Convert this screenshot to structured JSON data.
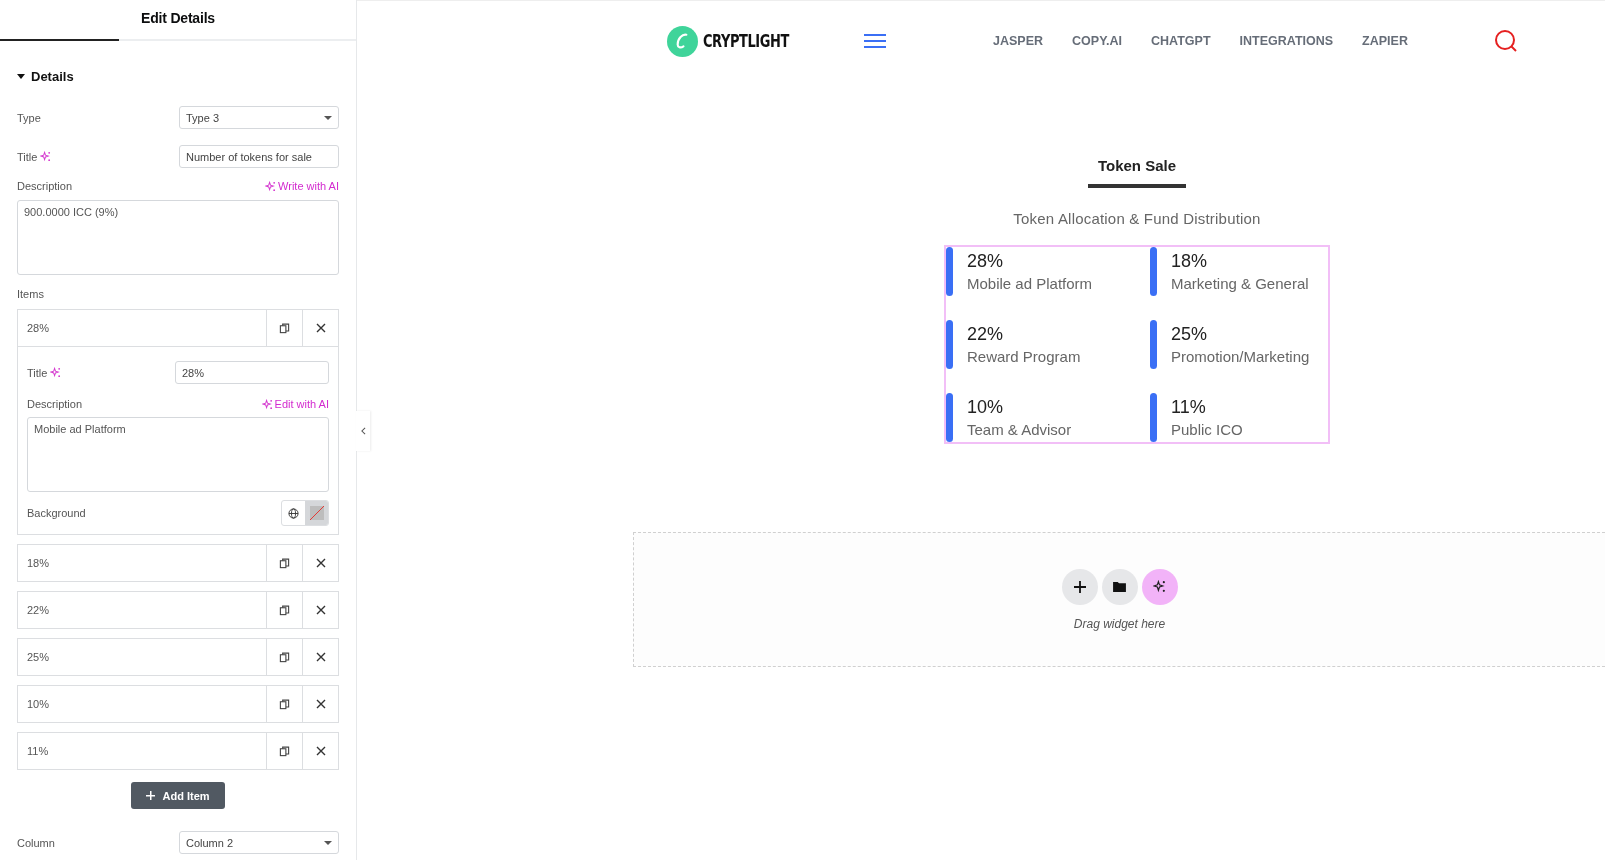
{
  "panel": {
    "title": "Edit Details",
    "section": {
      "label": "Details",
      "expanded": true
    },
    "type": {
      "label": "Type",
      "value": "Type 3"
    },
    "title_field": {
      "label": "Title",
      "value": "Number of tokens for sale"
    },
    "description": {
      "label": "Description",
      "ai_link": "Write with AI",
      "value": "900.0000 ICC (9%)"
    },
    "items_label": "Items",
    "items": [
      {
        "title": "28%",
        "expanded": true,
        "title_label": "Title",
        "title_value": "28%",
        "description_label": "Description",
        "ai_link": "Edit with AI",
        "description_value": "Mobile ad Platform",
        "background_label": "Background"
      },
      {
        "title": "18%",
        "expanded": false
      },
      {
        "title": "22%",
        "expanded": false
      },
      {
        "title": "25%",
        "expanded": false
      },
      {
        "title": "10%",
        "expanded": false
      },
      {
        "title": "11%",
        "expanded": false
      }
    ],
    "add_button": "Add Item",
    "column": {
      "label": "Column",
      "value": "Column 2"
    }
  },
  "nav": {
    "logo": "CRYPTLIGHT",
    "links": [
      "JASPER",
      "COPY.AI",
      "CHATGPT",
      "INTEGRATIONS",
      "ZAPIER"
    ]
  },
  "section": {
    "tab": {
      "label": "Token Sale",
      "selected": true
    },
    "subtitle": "Token Allocation & Fund Distribution",
    "stats": [
      {
        "value": "28%",
        "label": "Mobile ad Platform"
      },
      {
        "value": "18%",
        "label": "Marketing & General"
      },
      {
        "value": "22%",
        "label": "Reward Program"
      },
      {
        "value": "25%",
        "label": "Promotion/Marketing"
      },
      {
        "value": "10%",
        "label": "Team & Advisor"
      },
      {
        "value": "11%",
        "label": "Public ICO"
      }
    ]
  },
  "dropzone": {
    "hint": "Drag widget here"
  }
}
